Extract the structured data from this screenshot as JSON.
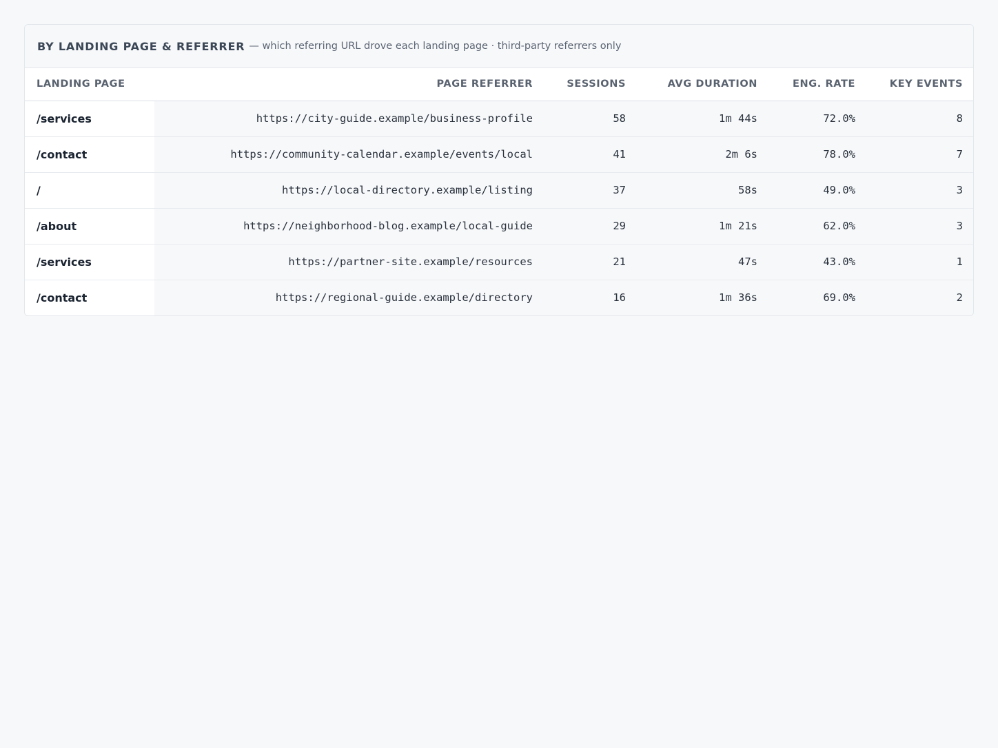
{
  "panel": {
    "title": "BY LANDING PAGE & REFERRER",
    "subtitle": "— which referring URL drove each landing page · third-party referrers only"
  },
  "table": {
    "columns": [
      "LANDING PAGE",
      "PAGE REFERRER",
      "SESSIONS",
      "AVG DURATION",
      "ENG. RATE",
      "KEY EVENTS"
    ],
    "rows": [
      {
        "landing": "/services",
        "referrer": "https://city-guide.example/business-profile",
        "sessions": "58",
        "duration": "1m 44s",
        "rate": "72.0%",
        "events": "8"
      },
      {
        "landing": "/contact",
        "referrer": "https://community-calendar.example/events/local",
        "sessions": "41",
        "duration": "2m 6s",
        "rate": "78.0%",
        "events": "7"
      },
      {
        "landing": "/",
        "referrer": "https://local-directory.example/listing",
        "sessions": "37",
        "duration": "58s",
        "rate": "49.0%",
        "events": "3"
      },
      {
        "landing": "/about",
        "referrer": "https://neighborhood-blog.example/local-guide",
        "sessions": "29",
        "duration": "1m 21s",
        "rate": "62.0%",
        "events": "3"
      },
      {
        "landing": "/services",
        "referrer": "https://partner-site.example/resources",
        "sessions": "21",
        "duration": "47s",
        "rate": "43.0%",
        "events": "1"
      },
      {
        "landing": "/contact",
        "referrer": "https://regional-guide.example/directory",
        "sessions": "16",
        "duration": "1m 36s",
        "rate": "69.0%",
        "events": "2"
      }
    ]
  }
}
